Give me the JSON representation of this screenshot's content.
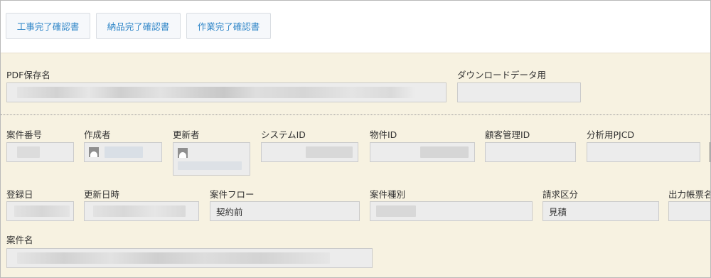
{
  "toolbar": {
    "buttons": [
      "工事完了確認書",
      "納品完了確認書",
      "作業完了確認書"
    ]
  },
  "form": {
    "pdf_name_label": "PDF保存名",
    "download_label": "ダウンロードデータ用",
    "row1": {
      "case_no_label": "案件番号",
      "creator_label": "作成者",
      "updater_label": "更新者",
      "system_id_label": "システムID",
      "property_id_label": "物件ID",
      "customer_id_label": "顧客管理ID",
      "analysis_pjcd_label": "分析用PJCD"
    },
    "row2": {
      "reg_date_label": "登録日",
      "update_datetime_label": "更新日時",
      "case_flow_label": "案件フロー",
      "case_flow_value": "契約前",
      "case_type_label": "案件種別",
      "billing_label": "請求区分",
      "billing_value": "見積",
      "output_form_label": "出力帳票名"
    },
    "case_name_label": "案件名"
  },
  "colors": {
    "button_text": "#2f86c8",
    "form_bg": "#f7f2e1",
    "field_bg": "#ececec"
  }
}
